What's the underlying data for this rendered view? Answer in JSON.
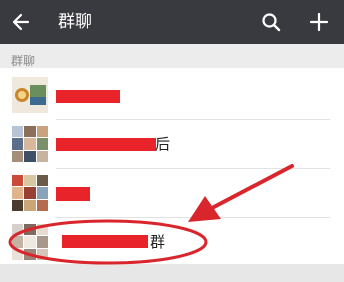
{
  "header": {
    "title": "群聊",
    "back_icon": "arrow-left-icon",
    "search_icon": "search-icon",
    "add_icon": "plus-icon"
  },
  "section": {
    "label": "群聊"
  },
  "groups": [
    {
      "name_suffix": ""
    },
    {
      "name_suffix": "后"
    },
    {
      "name_suffix": ""
    },
    {
      "name_suffix": "群"
    }
  ],
  "colors": {
    "topbar": "#393a3f",
    "redaction": "#e8242a",
    "annotation": "#d9262c"
  }
}
